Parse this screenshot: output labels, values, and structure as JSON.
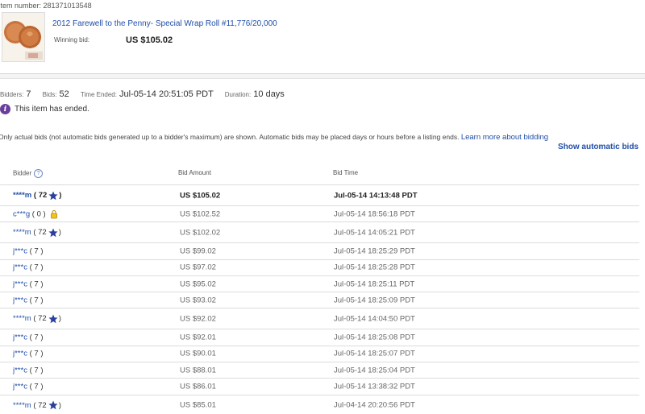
{
  "item": {
    "number_text": "Item number: 281371013548",
    "title": "2012 Farewell to the Penny- Special Wrap Roll #11,776/20,000",
    "winning_label": "Winning bid:",
    "winning_value": "US $105.02"
  },
  "stats": {
    "bidders_label": "Bidders:",
    "bidders_value": "7",
    "bids_label": "Bids:",
    "bids_value": "52",
    "time_ended_label": "Time Ended:",
    "time_ended_value": "Jul-05-14 20:51:05 PDT",
    "duration_label": "Duration:",
    "duration_value": "10 days"
  },
  "notice": {
    "ended_text": "This item has ended."
  },
  "disclaimer": {
    "text": "Only actual bids (not automatic bids generated up to a bidder's maximum) are shown. Automatic bids may be placed days or hours before a listing ends.",
    "link": "Learn more about bidding"
  },
  "show_automatic_label": "Show automatic bids",
  "table": {
    "headers": {
      "bidder": "Bidder",
      "amount": "Bid Amount",
      "time": "Bid Time"
    },
    "rows": [
      {
        "name": "****m",
        "score": "( 72",
        "close": ")",
        "amount": "US $105.02",
        "time": "Jul-05-14 14:13:48 PDT"
      },
      {
        "name": "c***g",
        "score": "( 0 )",
        "close": "",
        "amount": "US $102.52",
        "time": "Jul-05-14 18:56:18 PDT"
      },
      {
        "name": "****m",
        "score": "( 72",
        "close": ")",
        "amount": "US $102.02",
        "time": "Jul-05-14 14:05:21 PDT"
      },
      {
        "name": "j***c",
        "score": "( 7 )",
        "close": "",
        "amount": "US $99.02",
        "time": "Jul-05-14 18:25:29 PDT"
      },
      {
        "name": "j***c",
        "score": "( 7 )",
        "close": "",
        "amount": "US $97.02",
        "time": "Jul-05-14 18:25:28 PDT"
      },
      {
        "name": "j***c",
        "score": "( 7 )",
        "close": "",
        "amount": "US $95.02",
        "time": "Jul-05-14 18:25:11 PDT"
      },
      {
        "name": "j***c",
        "score": "( 7 )",
        "close": "",
        "amount": "US $93.02",
        "time": "Jul-05-14 18:25:09 PDT"
      },
      {
        "name": "****m",
        "score": "( 72",
        "close": ")",
        "amount": "US $92.02",
        "time": "Jul-05-14 14:04:50 PDT"
      },
      {
        "name": "j***c",
        "score": "( 7 )",
        "close": "",
        "amount": "US $92.01",
        "time": "Jul-05-14 18:25:08 PDT"
      },
      {
        "name": "j***c",
        "score": "( 7 )",
        "close": "",
        "amount": "US $90.01",
        "time": "Jul-05-14 18:25:07 PDT"
      },
      {
        "name": "j***c",
        "score": "( 7 )",
        "close": "",
        "amount": "US $88.01",
        "time": "Jul-05-14 18:25:04 PDT"
      },
      {
        "name": "j***c",
        "score": "( 7 )",
        "close": "",
        "amount": "US $86.01",
        "time": "Jul-05-14 13:38:32 PDT"
      },
      {
        "name": "****m",
        "score": "( 72",
        "close": ")",
        "amount": "US $85.01",
        "time": "Jul-04-14 20:20:56 PDT"
      }
    ]
  }
}
